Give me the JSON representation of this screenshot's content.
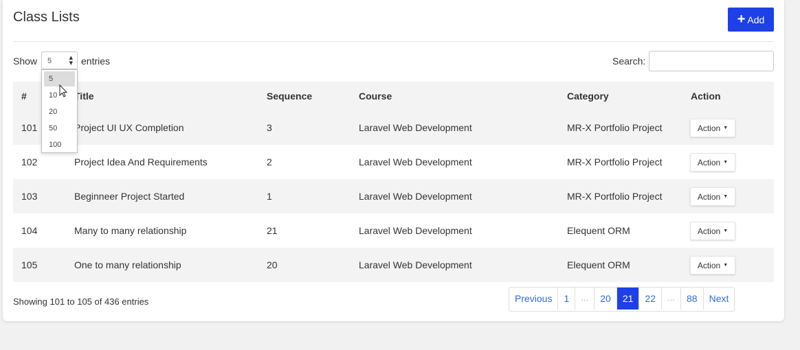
{
  "header": {
    "title": "Class Lists",
    "add_label": "Add"
  },
  "length_menu": {
    "show_label": "Show",
    "entries_label": "entries",
    "selected": "5",
    "options": [
      "5",
      "10",
      "20",
      "50",
      "100"
    ]
  },
  "search": {
    "label": "Search:",
    "value": ""
  },
  "table": {
    "columns": [
      "#",
      "Title",
      "Sequence",
      "Course",
      "Category",
      "Action"
    ],
    "rows": [
      {
        "id": "101",
        "title": "Project UI UX Completion",
        "sequence": "3",
        "course": "Laravel Web Development",
        "category": "MR-X Portfolio Project",
        "action": "Action"
      },
      {
        "id": "102",
        "title": "Project Idea And Requirements",
        "sequence": "2",
        "course": "Laravel Web Development",
        "category": "MR-X Portfolio Project",
        "action": "Action"
      },
      {
        "id": "103",
        "title": "Beginneer Project Started",
        "sequence": "1",
        "course": "Laravel Web Development",
        "category": "MR-X Portfolio Project",
        "action": "Action"
      },
      {
        "id": "104",
        "title": "Many to many relationship",
        "sequence": "21",
        "course": "Laravel Web Development",
        "category": "Elequent ORM",
        "action": "Action"
      },
      {
        "id": "105",
        "title": "One to many relationship",
        "sequence": "20",
        "course": "Laravel Web Development",
        "category": "Elequent ORM",
        "action": "Action"
      }
    ]
  },
  "info": "Showing 101 to 105 of 436 entries",
  "pagination": {
    "previous": "Previous",
    "next": "Next",
    "pages": [
      "1",
      "…",
      "20",
      "21",
      "22",
      "…",
      "88"
    ],
    "active": "21"
  },
  "colors": {
    "primary": "#1e40e8",
    "link": "#2f6bdb",
    "stripe": "#f3f3f4"
  },
  "icons": {
    "add": "plus-icon",
    "select": "select-arrows-icon",
    "action": "caret-down-icon",
    "pointer": "cursor-icon"
  }
}
